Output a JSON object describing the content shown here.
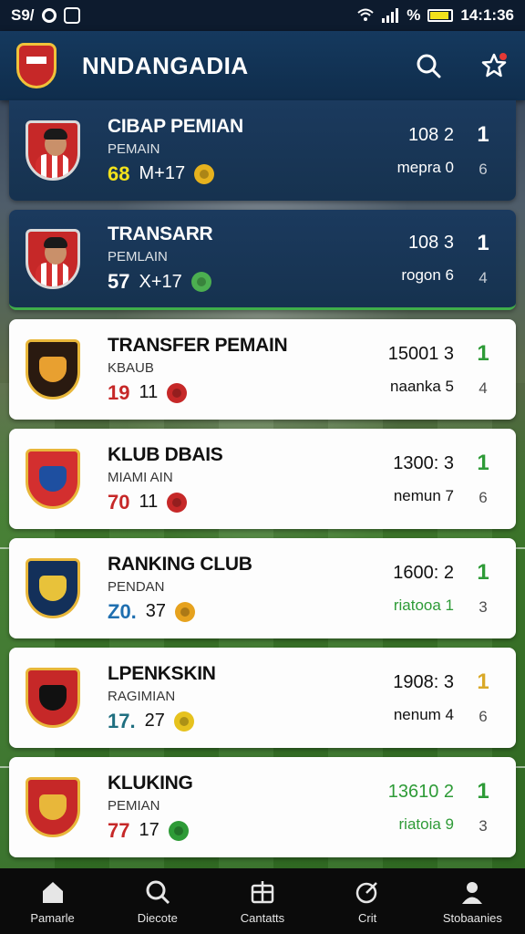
{
  "status_bar": {
    "left_text": "S9/",
    "time": "14:1:36",
    "signal_text": "%"
  },
  "app_bar": {
    "title": "NNDANGADIA"
  },
  "colors": {
    "header": "#15395e",
    "accent_red": "#c62828",
    "accent_green": "#2e9b37",
    "gold": "#d9a928"
  },
  "items": [
    {
      "name": "CIBAP PEMIAN",
      "sub": "PEMAIN",
      "rating": "68",
      "extra": "M+17",
      "price": "108 2",
      "price_sub": "mepra 0",
      "rank": "1",
      "rank_sub": "6",
      "rating_color": "#f2e21c",
      "coin_color": "#e6b21e",
      "badge_icon": "player-avatar-icon"
    },
    {
      "name": "TRANSARR",
      "sub": "PEMLAIN",
      "rating": "57",
      "extra": "X+17",
      "price": "108 3",
      "price_sub": "rogon 6",
      "rank": "1",
      "rank_sub": "4",
      "rating_color": "#ffffff",
      "coin_color": "#4caf50",
      "badge_icon": "player-avatar-icon"
    },
    {
      "name": "TRANSFER PEMAIN",
      "sub": "KBAUB",
      "rating": "19",
      "extra": "11",
      "price": "15001 3",
      "price_sub": "naanka 5",
      "rank": "1",
      "rank_sub": "4",
      "rating_color": "#c62828",
      "rank_color": "#2e9b37",
      "coin_color": "#c62828",
      "badge_icon": "club-crest-icon",
      "crest_bg": "#2a1a10",
      "crest_inner": "#e8a030"
    },
    {
      "name": "KLUB DBAIS",
      "sub": "MIAMI AIN",
      "rating": "70",
      "extra": "11",
      "price": "1300: 3",
      "price_sub": "nemun 7",
      "rank": "1",
      "rank_sub": "6",
      "rating_color": "#c62828",
      "rank_color": "#2e9b37",
      "coin_color": "#c62828",
      "badge_icon": "club-crest-icon",
      "crest_bg": "#d32f2f",
      "crest_inner": "#1e4fa0"
    },
    {
      "name": "RANKING CLUB",
      "sub": "PENDAN",
      "rating": "Z0.",
      "extra": "37",
      "price": "1600: 2",
      "price_sub": "riatooa 1",
      "rank": "1",
      "rank_sub": "3",
      "rating_color": "#1f6fb0",
      "rank_color": "#2e9b37",
      "price_sub_color": "#2e9b37",
      "coin_color": "#e6a21e",
      "badge_icon": "club-crest-icon",
      "crest_bg": "#13305a",
      "crest_inner": "#e8c23a"
    },
    {
      "name": "LPENKSKIN",
      "sub": "RAGIMIAN",
      "rating": "17.",
      "extra": "27",
      "price": "1908: 3",
      "price_sub": "nenum 4",
      "rank": "1",
      "rank_sub": "6",
      "rating_color": "#1f6f80",
      "rank_color": "#d9a928",
      "coin_color": "#e6c21e",
      "badge_icon": "club-crest-icon",
      "crest_bg": "#c62828",
      "crest_inner": "#111111"
    },
    {
      "name": "KLUKING",
      "sub": "PEMIAN",
      "rating": "77",
      "extra": "17",
      "price": "13610 2",
      "price_sub": "riatoia 9",
      "rank": "1",
      "rank_sub": "3",
      "rating_color": "#c62828",
      "rank_color": "#2e9b37",
      "price_color": "#2e9b37",
      "price_sub_color": "#2e9b37",
      "coin_color": "#2e9b37",
      "badge_icon": "club-crest-icon",
      "crest_bg": "#c62828",
      "crest_inner": "#e8b73a"
    }
  ],
  "bottom_nav": [
    {
      "label": "Pamarle",
      "icon": "home-icon"
    },
    {
      "label": "Diecote",
      "icon": "search-icon"
    },
    {
      "label": "Cantatts",
      "icon": "contacts-icon"
    },
    {
      "label": "Crit",
      "icon": "chart-icon"
    },
    {
      "label": "Stobaanies",
      "icon": "profile-icon"
    }
  ]
}
